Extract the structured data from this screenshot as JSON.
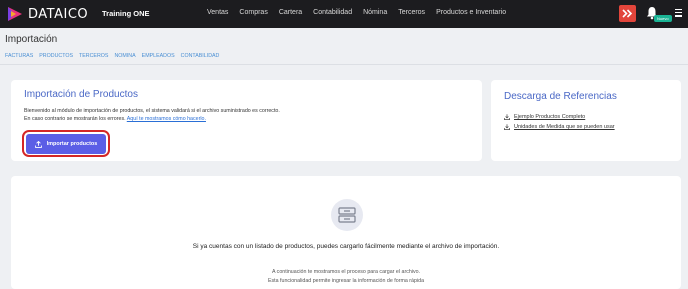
{
  "app": {
    "brand": "DATAICO",
    "company": "Training ONE",
    "nav": [
      "Ventas",
      "Compras",
      "Cartera",
      "Contabilidad",
      "Nómina",
      "Terceros",
      "Productos e Inventario"
    ],
    "badge": "Nuevo"
  },
  "page": {
    "title": "Importación",
    "subnav": [
      "FACTURAS",
      "PRODUCTOS",
      "TERCEROS",
      "NOMINA",
      "EMPLEADOS",
      "CONTABILIDAD"
    ]
  },
  "import_card": {
    "title": "Importación de Productos",
    "intro_line1": "Bienvenido al módulo de importación de productos, el sistema validará si el archivo suministrado es correcto.",
    "intro_line2": "En caso contrario se mostrarán los errores.",
    "intro_link": "Aquí te mostramos cómo hacerlo.",
    "button_label": "Importar productos"
  },
  "downloads_card": {
    "title": "Descarga de Referencias",
    "items": [
      "Ejemplo Productos Completo",
      "Unidades de Medida que se pueden usar"
    ]
  },
  "info_card": {
    "main": "Si ya cuentas con un listado de productos, puedes cargarlo fácilmente mediante el archivo de importación.",
    "sub1": "A continuación te mostramos el proceso para cargar el archivo.",
    "sub2": "Esta funcionalidad permite ingresar la información de forma rápida"
  },
  "colors": {
    "topbar": "#1c1c1f",
    "accent": "#5b5ee6",
    "title_blue": "#4a68c6",
    "link": "#2a6fd6",
    "highlight": "#d42626",
    "alert": "#e2453b",
    "badge": "#1ab394"
  }
}
